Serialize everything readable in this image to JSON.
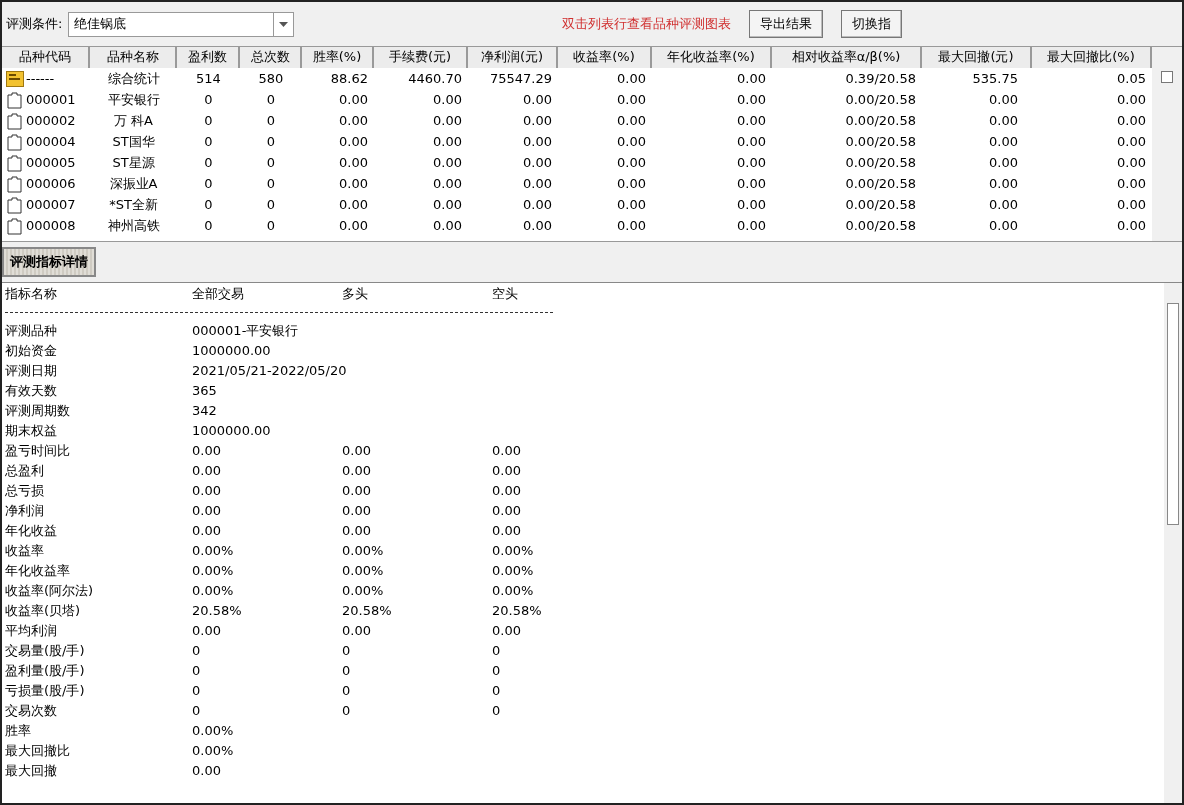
{
  "toolbar": {
    "label": "评测条件:",
    "condition": "绝佳锅底",
    "hint": "双击列表行查看品种评测图表",
    "buttons": [
      "导出结果",
      "切换指"
    ]
  },
  "table": {
    "columns": [
      "品种代码",
      "品种名称",
      "盈利数",
      "总次数",
      "胜率(%)",
      "手续费(元)",
      "净利润(元)",
      "收益率(%)",
      "年化收益率(%)",
      "相对收益率α/β(%)",
      "最大回撤(元)",
      "最大回撤比(%)"
    ],
    "rows": [
      {
        "kind": "summary",
        "cells": [
          "------",
          "综合统计",
          "514",
          "580",
          "88.62",
          "4460.70",
          "75547.29",
          "0.00",
          "0.00",
          "0.39/20.58",
          "535.75",
          "0.05"
        ]
      },
      {
        "kind": "stock",
        "cells": [
          "000001",
          "平安银行",
          "0",
          "0",
          "0.00",
          "0.00",
          "0.00",
          "0.00",
          "0.00",
          "0.00/20.58",
          "0.00",
          "0.00"
        ]
      },
      {
        "kind": "stock",
        "cells": [
          "000002",
          "万 科A",
          "0",
          "0",
          "0.00",
          "0.00",
          "0.00",
          "0.00",
          "0.00",
          "0.00/20.58",
          "0.00",
          "0.00"
        ]
      },
      {
        "kind": "stock",
        "cells": [
          "000004",
          "ST国华",
          "0",
          "0",
          "0.00",
          "0.00",
          "0.00",
          "0.00",
          "0.00",
          "0.00/20.58",
          "0.00",
          "0.00"
        ]
      },
      {
        "kind": "stock",
        "cells": [
          "000005",
          "ST星源",
          "0",
          "0",
          "0.00",
          "0.00",
          "0.00",
          "0.00",
          "0.00",
          "0.00/20.58",
          "0.00",
          "0.00"
        ]
      },
      {
        "kind": "stock",
        "cells": [
          "000006",
          "深振业A",
          "0",
          "0",
          "0.00",
          "0.00",
          "0.00",
          "0.00",
          "0.00",
          "0.00/20.58",
          "0.00",
          "0.00"
        ]
      },
      {
        "kind": "stock",
        "cells": [
          "000007",
          "*ST全新",
          "0",
          "0",
          "0.00",
          "0.00",
          "0.00",
          "0.00",
          "0.00",
          "0.00/20.58",
          "0.00",
          "0.00"
        ]
      },
      {
        "kind": "stock",
        "cells": [
          "000008",
          "神州高铁",
          "0",
          "0",
          "0.00",
          "0.00",
          "0.00",
          "0.00",
          "0.00",
          "0.00/20.58",
          "0.00",
          "0.00"
        ]
      }
    ]
  },
  "detail_tab": "评测指标详情",
  "detail": {
    "columns": [
      "指标名称",
      "全部交易",
      "多头",
      "空头"
    ],
    "rows": [
      {
        "label": "评测品种",
        "values": [
          "000001-平安银行"
        ]
      },
      {
        "label": "初始资金",
        "values": [
          "1000000.00"
        ]
      },
      {
        "label": "评测日期",
        "values": [
          "2021/05/21-2022/05/20"
        ]
      },
      {
        "label": "有效天数",
        "values": [
          "365"
        ]
      },
      {
        "label": "评测周期数",
        "values": [
          "342"
        ]
      },
      {
        "label": "期末权益",
        "values": [
          "1000000.00"
        ]
      },
      {
        "label": "盈亏时间比",
        "values": [
          "0.00",
          "0.00",
          "0.00"
        ]
      },
      {
        "label": "总盈利",
        "values": [
          "0.00",
          "0.00",
          "0.00"
        ]
      },
      {
        "label": "总亏损",
        "values": [
          "0.00",
          "0.00",
          "0.00"
        ]
      },
      {
        "label": "净利润",
        "values": [
          "0.00",
          "0.00",
          "0.00"
        ]
      },
      {
        "label": "年化收益",
        "values": [
          "0.00",
          "0.00",
          "0.00"
        ]
      },
      {
        "label": "收益率",
        "values": [
          "0.00%",
          "0.00%",
          "0.00%"
        ]
      },
      {
        "label": "年化收益率",
        "values": [
          "0.00%",
          "0.00%",
          "0.00%"
        ]
      },
      {
        "label": "收益率(阿尔法)",
        "values": [
          "0.00%",
          "0.00%",
          "0.00%"
        ]
      },
      {
        "label": "收益率(贝塔)",
        "values": [
          "20.58%",
          "20.58%",
          "20.58%"
        ]
      },
      {
        "label": "平均利润",
        "values": [
          "0.00",
          "0.00",
          "0.00"
        ]
      },
      {
        "label": "交易量(股/手)",
        "values": [
          "0",
          "0",
          "0"
        ]
      },
      {
        "label": "盈利量(股/手)",
        "values": [
          "0",
          "0",
          "0"
        ]
      },
      {
        "label": "亏损量(股/手)",
        "values": [
          "0",
          "0",
          "0"
        ]
      },
      {
        "label": "交易次数",
        "values": [
          "0",
          "0",
          "0"
        ]
      },
      {
        "label": "胜率",
        "values": [
          "0.00%"
        ]
      },
      {
        "label": "最大回撤比",
        "values": [
          "0.00%"
        ]
      },
      {
        "label": "最大回撤",
        "values": [
          "0.00"
        ]
      }
    ]
  }
}
